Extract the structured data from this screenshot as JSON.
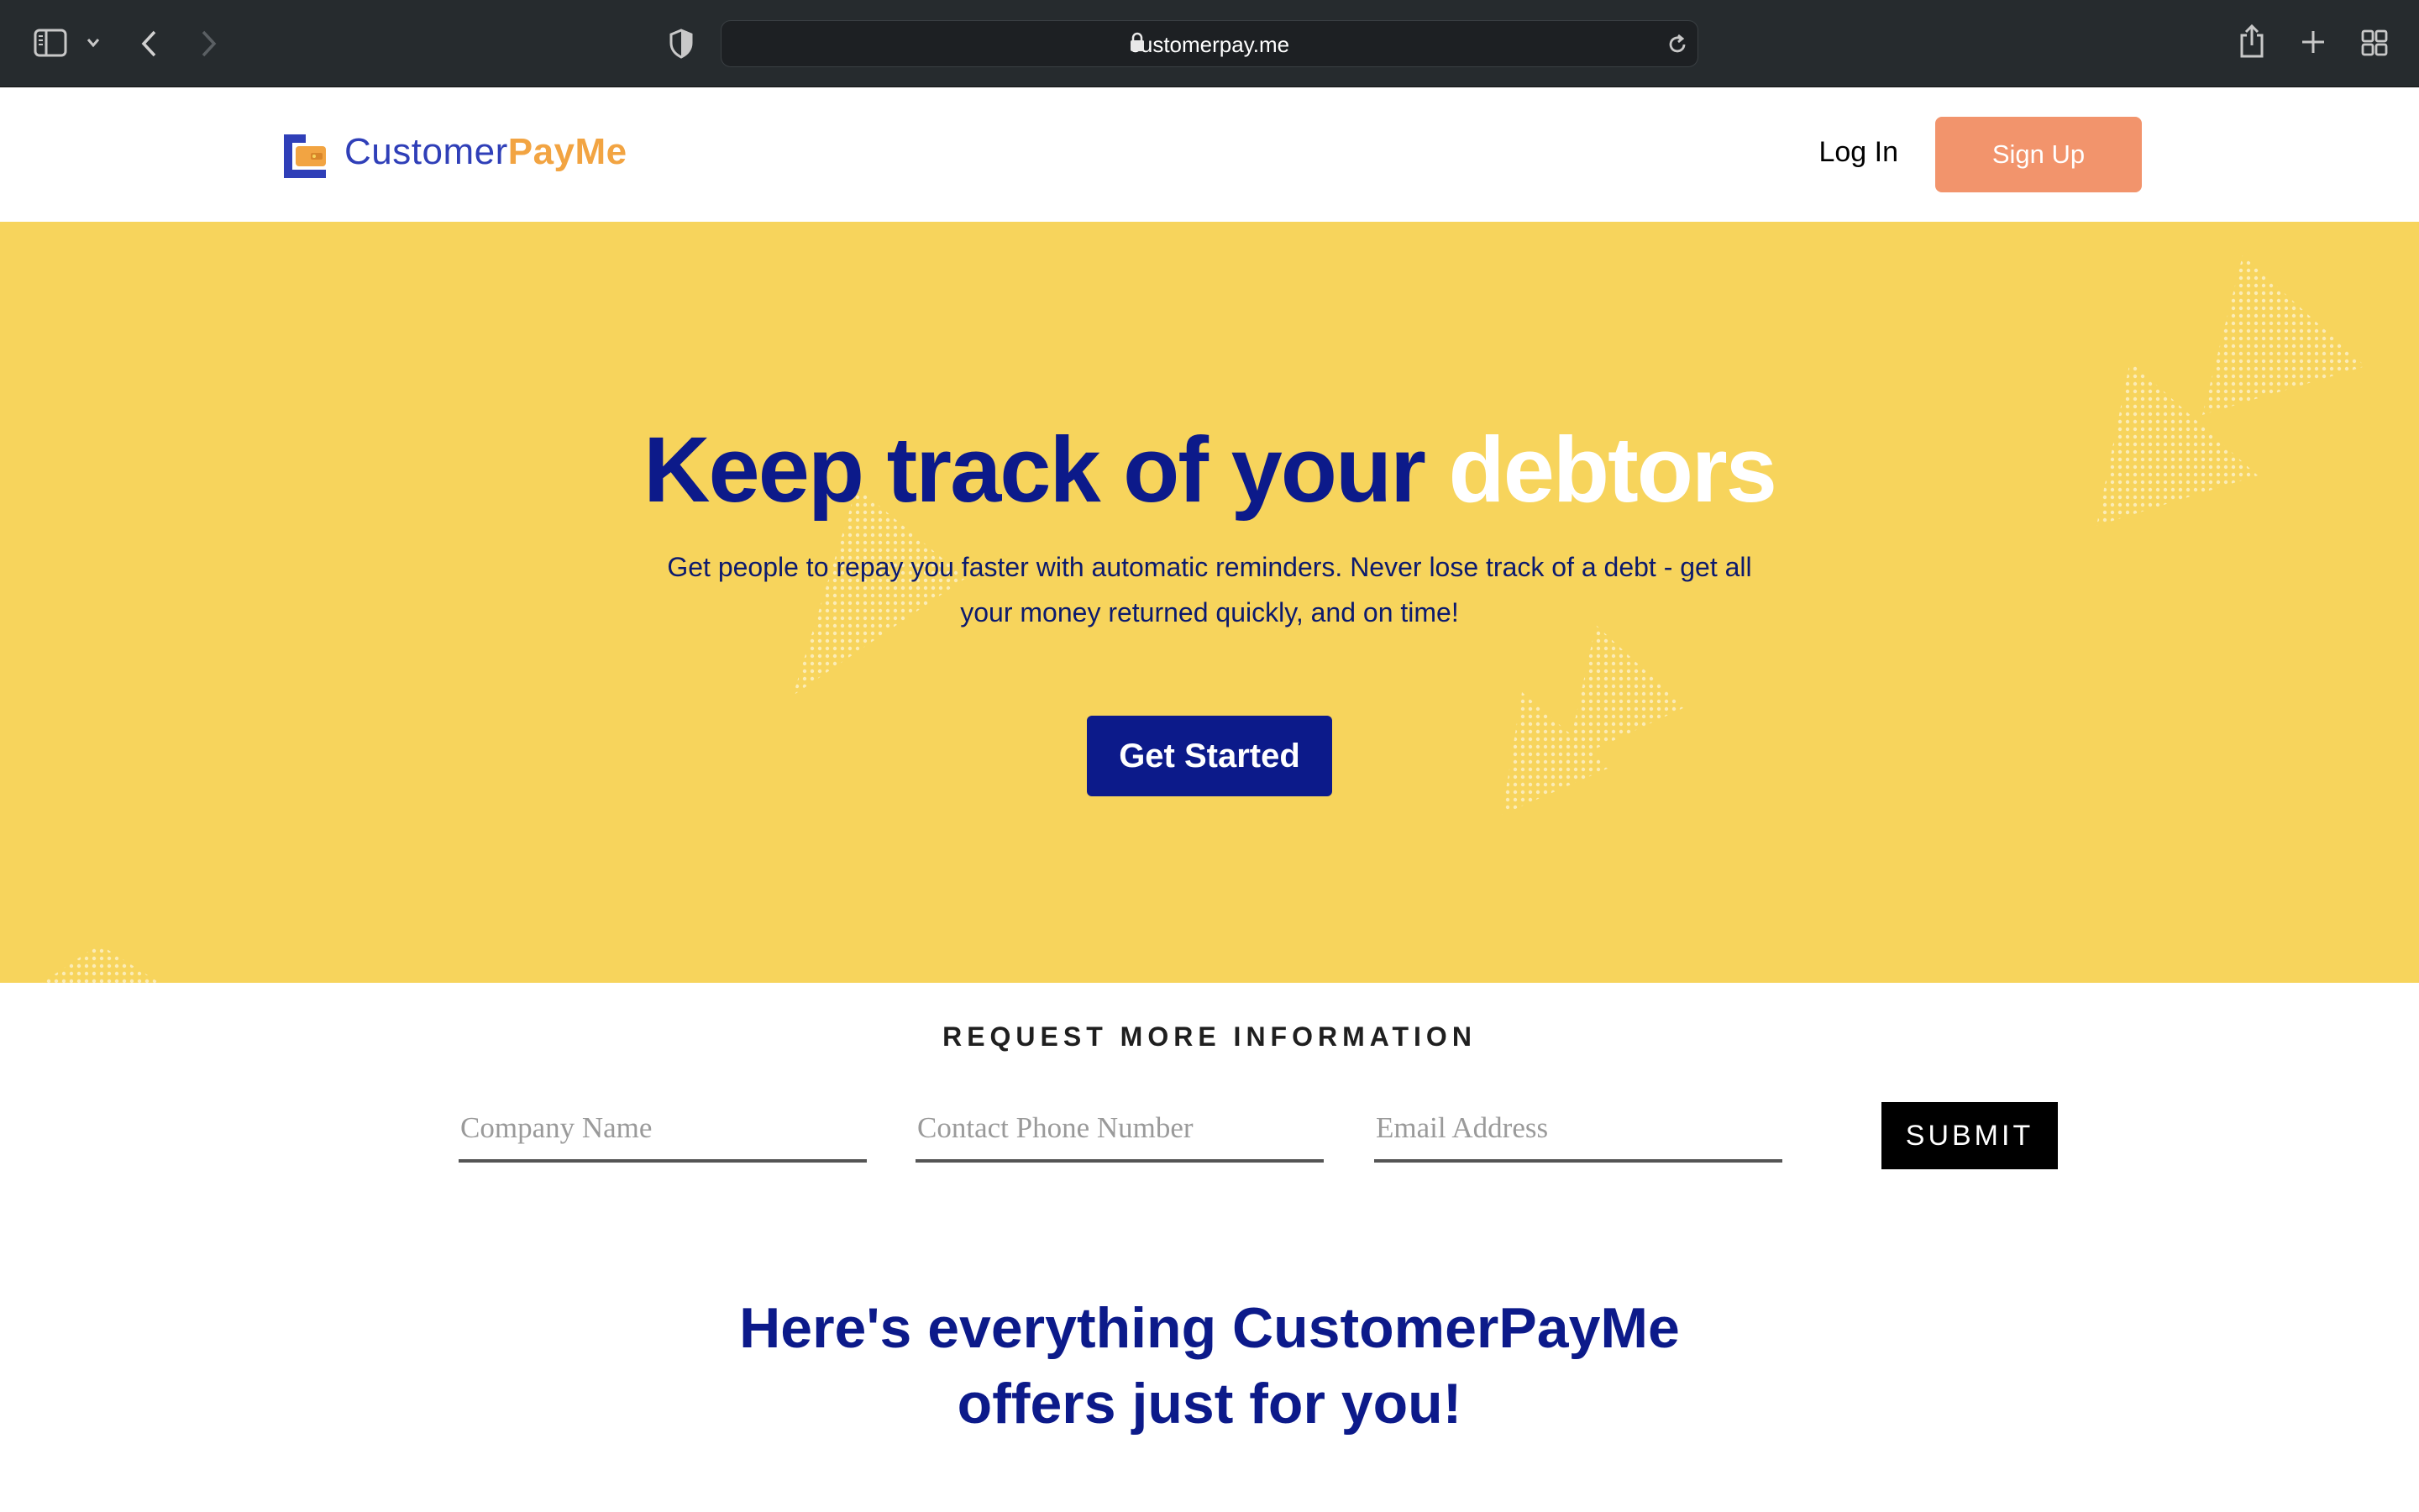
{
  "browser": {
    "url": "customerpay.me"
  },
  "header": {
    "logo_part1": "Customer",
    "logo_part2": "PayMe",
    "login_label": "Log In",
    "signup_label": "Sign Up"
  },
  "hero": {
    "title_main": "Keep track of your",
    "title_highlight": "debtors",
    "subtitle": "Get people to repay you faster with automatic reminders. Never lose track of a debt - get all your money returned quickly, and on time!",
    "cta_label": "Get Started"
  },
  "request_form": {
    "title": "REQUEST MORE INFORMATION",
    "company_placeholder": "Company Name",
    "phone_placeholder": "Contact Phone Number",
    "email_placeholder": "Email Address",
    "submit_label": "SUBMIT"
  },
  "features": {
    "heading": "Here's everything CustomerPayMe offers just for you!"
  },
  "colors": {
    "brand_navy": "#0c1a8a",
    "brand_blue": "#2f3fb8",
    "brand_orange": "#f2a442",
    "hero_yellow": "#f7d45c",
    "signup_coral": "#f2946c"
  }
}
